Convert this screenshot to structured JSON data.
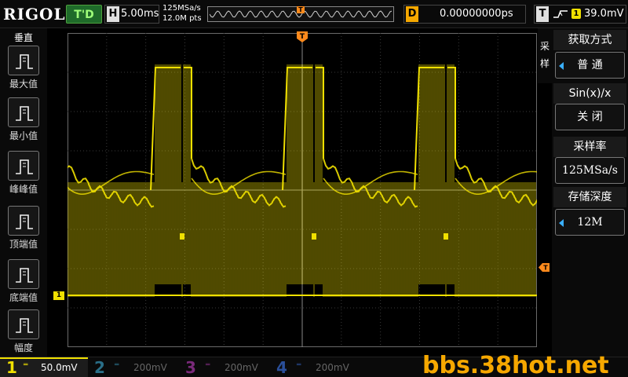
{
  "header": {
    "brand": "RIGOL",
    "trigger_status": "T'D",
    "horizontal_label": "H",
    "timebase": "5.00ms",
    "sample_rate": "125MSa/s",
    "memory_points": "12.0M pts",
    "memory_trigger_label": "T",
    "delay_label": "D",
    "delay_value": "0.00000000ps",
    "trigger_label": "T",
    "trigger_source": "1",
    "trigger_level": "39.0mV"
  },
  "left_menu": {
    "title": "垂直",
    "items": [
      {
        "label": "最大值",
        "icon": "max-measure-icon"
      },
      {
        "label": "最小值",
        "icon": "min-measure-icon"
      },
      {
        "label": "峰峰值",
        "icon": "peak-to-peak-icon"
      },
      {
        "label": "顶端值",
        "icon": "top-value-icon"
      },
      {
        "label": "底端值",
        "icon": "base-value-icon"
      },
      {
        "label": "幅度",
        "icon": "amplitude-icon"
      }
    ]
  },
  "right_menu": {
    "side_tab": "采样",
    "acq_title": "获取方式",
    "acq_value": "普 通",
    "sinx_title": "Sin(x)/x",
    "sinx_value": "关 闭",
    "rate_title": "采样率",
    "rate_value": "125MSa/s",
    "depth_title": "存储深度",
    "depth_value": "12M"
  },
  "screen": {
    "ch1_marker": "1",
    "trigger_marker": "T"
  },
  "channels": [
    {
      "num": "1",
      "scale": "50.0mV",
      "color": "#f0e000"
    },
    {
      "num": "2",
      "scale": "200mV",
      "color": "#00bfff"
    },
    {
      "num": "3",
      "scale": "200mV",
      "color": "#d040d0"
    },
    {
      "num": "4",
      "scale": "200mV",
      "color": "#4080ff"
    }
  ],
  "watermark": "bbs.38hot.net",
  "colors": {
    "trace": "#f0e000",
    "trigger": "#ff8a1c",
    "menu_accent": "#3ab0ff"
  }
}
